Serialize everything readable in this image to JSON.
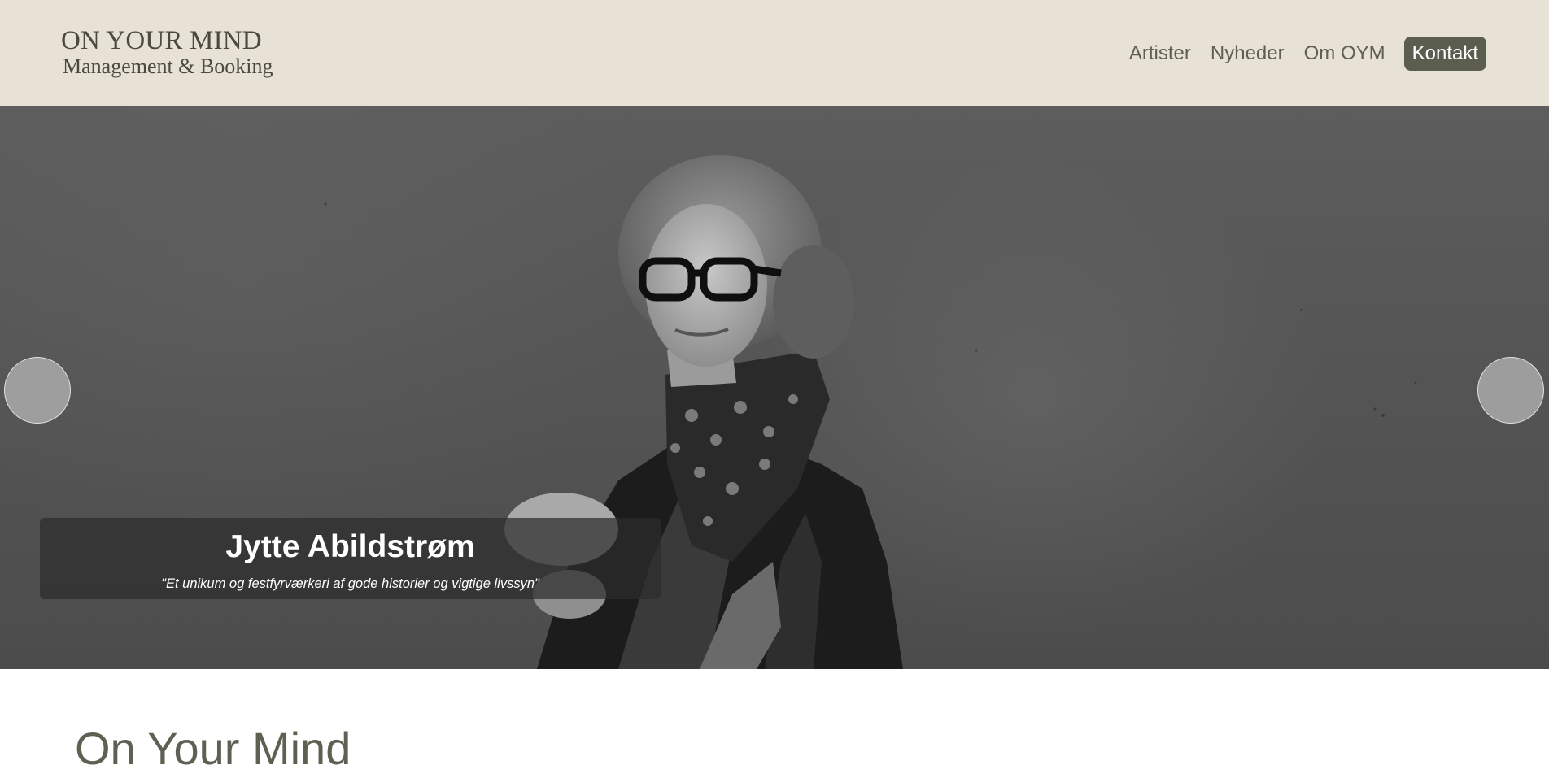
{
  "header": {
    "logo_line1": "ON YOUR MIND",
    "logo_line2": "Management & Booking",
    "nav": [
      {
        "label": "Artister"
      },
      {
        "label": "Nyheder"
      },
      {
        "label": "Om OYM"
      },
      {
        "label": "Kontakt"
      }
    ]
  },
  "hero": {
    "slide_title": "Jytte Abildstrøm",
    "slide_quote": "\"Et unikum og festfyrværkeri af gode historier og vigtige livssyn\""
  },
  "main": {
    "section_title": "On Your Mind"
  },
  "colors": {
    "header_bg": "#e7e1d6",
    "brand_text": "#5f5f52",
    "accent_button": "#5b5d4e"
  }
}
